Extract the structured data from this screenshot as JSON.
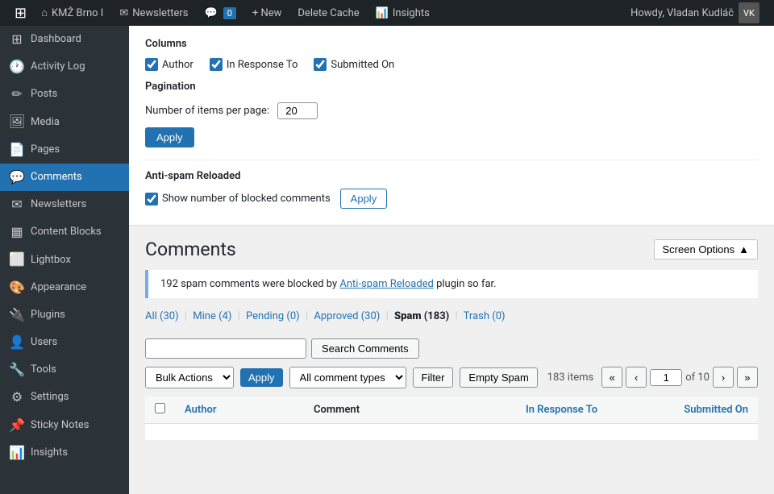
{
  "adminBar": {
    "logo": "⊞",
    "site": "KMŽ Brno I",
    "newsletters": "Newsletters",
    "comments": "0",
    "new": "+ New",
    "deleteCache": "Delete Cache",
    "insights": "Insights",
    "howdy": "Howdy, Vladan Kudláč"
  },
  "sidebar": {
    "items": [
      {
        "id": "dashboard",
        "label": "Dashboard",
        "icon": "⊞"
      },
      {
        "id": "activity-log",
        "label": "Activity Log",
        "icon": "🕐"
      },
      {
        "id": "posts",
        "label": "Posts",
        "icon": "✏"
      },
      {
        "id": "media",
        "label": "Media",
        "icon": "🖼"
      },
      {
        "id": "pages",
        "label": "Pages",
        "icon": "📄"
      },
      {
        "id": "comments",
        "label": "Comments",
        "icon": "💬",
        "active": true
      },
      {
        "id": "newsletters",
        "label": "Newsletters",
        "icon": "✉"
      },
      {
        "id": "content-blocks",
        "label": "Content Blocks",
        "icon": "▦"
      },
      {
        "id": "lightbox",
        "label": "Lightbox",
        "icon": "⬜"
      },
      {
        "id": "appearance",
        "label": "Appearance",
        "icon": "🎨"
      },
      {
        "id": "plugins",
        "label": "Plugins",
        "icon": "🔌"
      },
      {
        "id": "users",
        "label": "Users",
        "icon": "👤"
      },
      {
        "id": "tools",
        "label": "Tools",
        "icon": "🔧"
      },
      {
        "id": "settings",
        "label": "Settings",
        "icon": "⚙"
      },
      {
        "id": "sticky-notes",
        "label": "Sticky Notes",
        "icon": "📌"
      },
      {
        "id": "insights",
        "label": "Insights",
        "icon": "📊"
      }
    ]
  },
  "screenOptions": {
    "title": "Columns",
    "columns": [
      {
        "id": "author",
        "label": "Author",
        "checked": true
      },
      {
        "id": "in-response-to",
        "label": "In Response To",
        "checked": true
      },
      {
        "id": "submitted-on",
        "label": "Submitted On",
        "checked": true
      }
    ],
    "paginationTitle": "Pagination",
    "itemsPerPageLabel": "Number of items per page:",
    "itemsPerPageValue": "20",
    "applyLabel": "Apply",
    "antispamTitle": "Anti-spam Reloaded",
    "antispamCheckLabel": "Show number of blocked comments",
    "antispamApplyLabel": "Apply"
  },
  "comments": {
    "title": "Comments",
    "screenOptionsBtn": "Screen Options",
    "spamNotice": "192 spam comments were blocked by ",
    "spamNoticeLinkText": "Anti-spam Reloaded",
    "spamNoticeSuffix": " plugin so far.",
    "filterTabs": [
      {
        "id": "all",
        "label": "All",
        "count": "(30)",
        "active": false
      },
      {
        "id": "mine",
        "label": "Mine",
        "count": "(4)",
        "active": false
      },
      {
        "id": "pending",
        "label": "Pending",
        "count": "(0)",
        "active": false
      },
      {
        "id": "approved",
        "label": "Approved",
        "count": "(30)",
        "active": false
      },
      {
        "id": "spam",
        "label": "Spam",
        "count": "(183)",
        "active": true
      },
      {
        "id": "trash",
        "label": "Trash",
        "count": "(0)",
        "active": false
      }
    ],
    "searchPlaceholder": "",
    "searchBtn": "Search Comments",
    "bulkActionsLabel": "Bulk Actions",
    "applyBtn": "Apply",
    "allCommentTypes": "All comment types",
    "filterBtn": "Filter",
    "emptySpamBtn": "Empty Spam",
    "itemsCount": "183 items",
    "currentPage": "1",
    "totalPages": "10",
    "tableColumns": {
      "author": "Author",
      "comment": "Comment",
      "inResponseTo": "In Response To",
      "submittedOn": "Submitted On"
    }
  }
}
